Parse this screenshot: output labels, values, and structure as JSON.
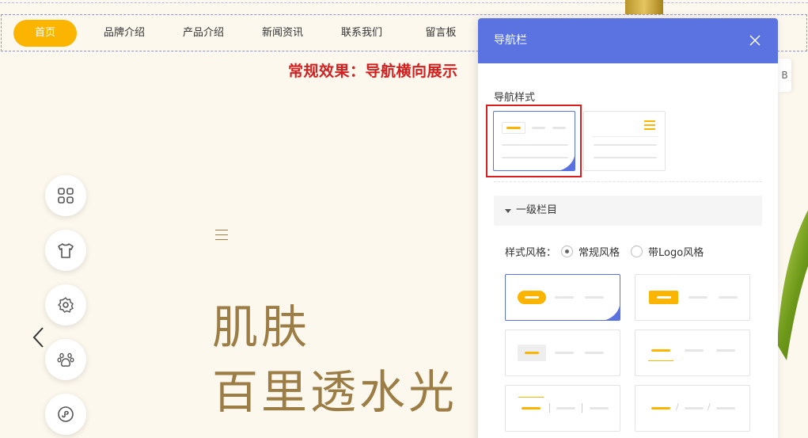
{
  "nav": {
    "items": [
      "首页",
      "品牌介绍",
      "产品介绍",
      "新闻资讯",
      "联系我们",
      "留言板"
    ],
    "active_index": 0,
    "accent_color": "#fbb400"
  },
  "headline": "常规效果：导航横向展示",
  "hero": {
    "line1": "肌肤",
    "line2": "百里透水光",
    "text_color": "#9c7d45"
  },
  "side_buttons": [
    "grid-icon",
    "tshirt-icon",
    "settings-icon",
    "paw-icon",
    "mini-program-icon"
  ],
  "prev_arrow_icon": "chevron-left-icon",
  "panel": {
    "title": "导航栏",
    "header_color": "#5a73e0",
    "nav_style_label": "导航样式",
    "nav_styles": [
      {
        "name": "horizontal",
        "selected": true
      },
      {
        "name": "hamburger",
        "selected": false
      }
    ],
    "level_label": "一级栏目",
    "style_label": "样式风格：",
    "style_options": [
      {
        "label": "常规风格",
        "checked": true
      },
      {
        "label": "带Logo风格",
        "checked": false
      }
    ],
    "side_tab_text": "B"
  }
}
